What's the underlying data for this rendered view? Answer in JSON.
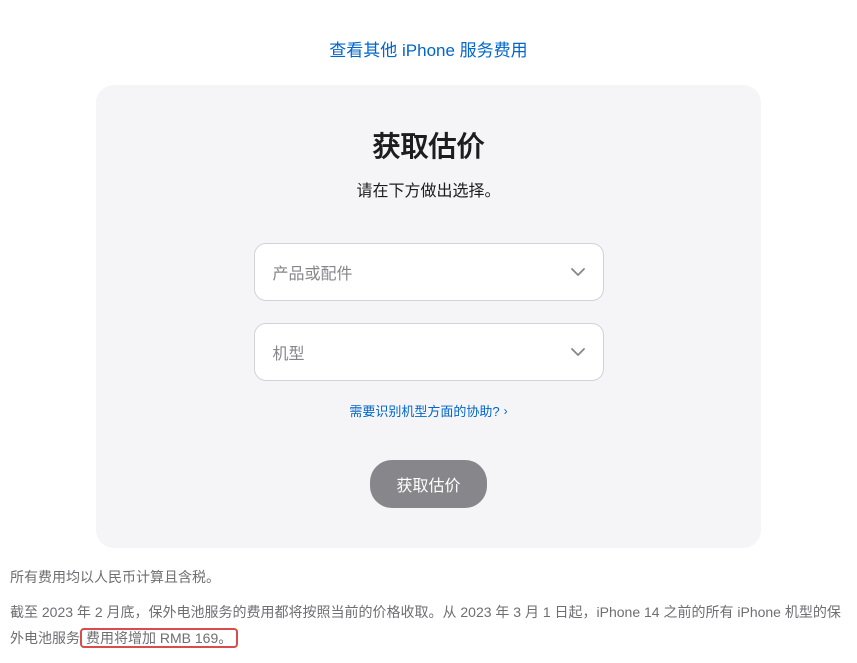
{
  "topLink": {
    "text": "查看其他 iPhone 服务费用"
  },
  "card": {
    "title": "获取估价",
    "subtitle": "请在下方做出选择。",
    "selects": {
      "product": {
        "placeholder": "产品或配件"
      },
      "model": {
        "placeholder": "机型"
      }
    },
    "helpLink": {
      "text": "需要识别机型方面的协助?"
    },
    "submitButton": {
      "label": "获取估价"
    }
  },
  "footer": {
    "line1": "所有费用均以人民币计算且含税。",
    "line2_part1": "截至 2023 年 2 月底，保外电池服务的费用都将按照当前的价格收取。从 2023 年 3 月 1 日起，iPhone 14 之前的所有 iPhone 机型的保外电池服务",
    "line2_highlight": "费用将增加 RMB 169。"
  }
}
